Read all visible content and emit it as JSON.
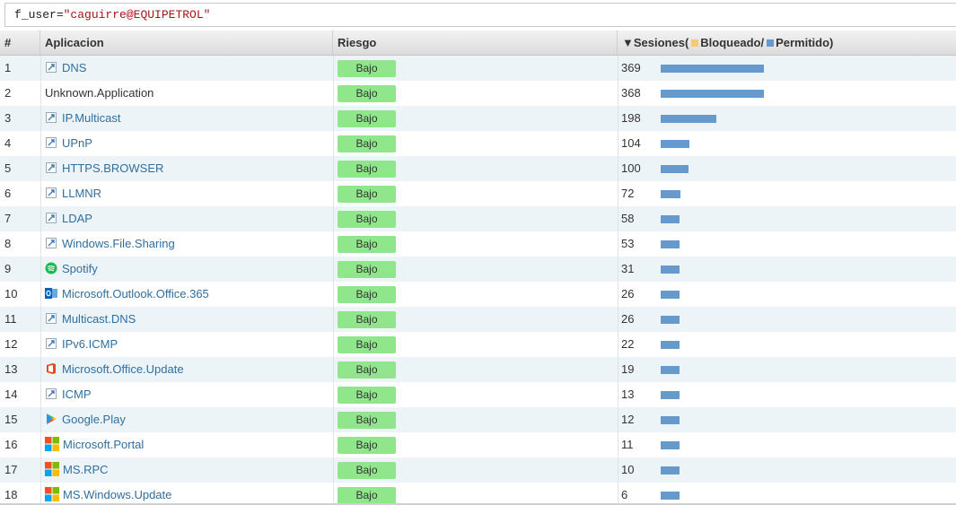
{
  "filter": {
    "key": "f_user",
    "eq": "=",
    "value": "\"caguirre@EQUIPETROL\""
  },
  "columns": {
    "index": "#",
    "app": "Aplicacion",
    "risk": "Riesgo",
    "sessions_prefix": "▼Sesiones(",
    "blocked": "Bloqueado/",
    "allowed": "Permitido)"
  },
  "colors": {
    "blocked": "#f5c97a",
    "allowed": "#6699cc",
    "risk_low": "#90e68a",
    "link": "#2f6f9f"
  },
  "max_sessions": 369,
  "rows": [
    {
      "n": "1",
      "app": "DNS",
      "icon": "generic-app-icon",
      "link": true,
      "risk": "Bajo",
      "sessions": 369
    },
    {
      "n": "2",
      "app": "Unknown.Application",
      "icon": "",
      "link": false,
      "risk": "Bajo",
      "sessions": 368
    },
    {
      "n": "3",
      "app": "IP.Multicast",
      "icon": "generic-app-icon",
      "link": true,
      "risk": "Bajo",
      "sessions": 198
    },
    {
      "n": "4",
      "app": "UPnP",
      "icon": "generic-app-icon",
      "link": true,
      "risk": "Bajo",
      "sessions": 104
    },
    {
      "n": "5",
      "app": "HTTPS.BROWSER",
      "icon": "generic-app-icon",
      "link": true,
      "risk": "Bajo",
      "sessions": 100
    },
    {
      "n": "6",
      "app": "LLMNR",
      "icon": "generic-app-icon",
      "link": true,
      "risk": "Bajo",
      "sessions": 72
    },
    {
      "n": "7",
      "app": "LDAP",
      "icon": "generic-app-icon",
      "link": true,
      "risk": "Bajo",
      "sessions": 58
    },
    {
      "n": "8",
      "app": "Windows.File.Sharing",
      "icon": "generic-app-icon",
      "link": true,
      "risk": "Bajo",
      "sessions": 53
    },
    {
      "n": "9",
      "app": "Spotify",
      "icon": "spotify-icon",
      "link": true,
      "risk": "Bajo",
      "sessions": 31
    },
    {
      "n": "10",
      "app": "Microsoft.Outlook.Office.365",
      "icon": "outlook-icon",
      "link": true,
      "risk": "Bajo",
      "sessions": 26
    },
    {
      "n": "11",
      "app": "Multicast.DNS",
      "icon": "generic-app-icon",
      "link": true,
      "risk": "Bajo",
      "sessions": 26
    },
    {
      "n": "12",
      "app": "IPv6.ICMP",
      "icon": "generic-app-icon",
      "link": true,
      "risk": "Bajo",
      "sessions": 22
    },
    {
      "n": "13",
      "app": "Microsoft.Office.Update",
      "icon": "office-icon",
      "link": true,
      "risk": "Bajo",
      "sessions": 19
    },
    {
      "n": "14",
      "app": "ICMP",
      "icon": "generic-app-icon",
      "link": true,
      "risk": "Bajo",
      "sessions": 13
    },
    {
      "n": "15",
      "app": "Google.Play",
      "icon": "google-play-icon",
      "link": true,
      "risk": "Bajo",
      "sessions": 12
    },
    {
      "n": "16",
      "app": "Microsoft.Portal",
      "icon": "windows-logo-icon",
      "link": true,
      "risk": "Bajo",
      "sessions": 11
    },
    {
      "n": "17",
      "app": "MS.RPC",
      "icon": "windows-logo-icon",
      "link": true,
      "risk": "Bajo",
      "sessions": 10
    },
    {
      "n": "18",
      "app": "MS.Windows.Update",
      "icon": "windows-logo-icon",
      "link": true,
      "risk": "Bajo",
      "sessions": 6
    }
  ]
}
